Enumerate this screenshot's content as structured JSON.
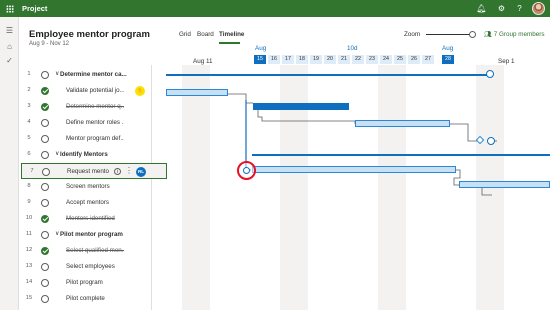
{
  "topbar": {
    "app_name": "Project",
    "icons": [
      "waffle-icon",
      "bell-icon",
      "gear-icon",
      "help-icon"
    ]
  },
  "leftnav": {
    "icons": [
      "hamburger-icon",
      "home-icon",
      "checkmark-icon"
    ]
  },
  "header": {
    "title": "Employee mentor program",
    "dates": "Aug 9 - Nov 12",
    "views": [
      "Grid",
      "Board",
      "Timeline"
    ],
    "active_view": "Timeline",
    "zoom_label": "Zoom",
    "members": "7 Group members"
  },
  "timeline_header": {
    "month": "Aug",
    "week_labels": [
      "Aug 11",
      "Sep 1"
    ],
    "range_label": "10d",
    "range_right_label": "Aug",
    "days": [
      "15",
      "16",
      "17",
      "18",
      "19",
      "20",
      "21",
      "22",
      "23",
      "24",
      "25",
      "26",
      "27",
      "28"
    ]
  },
  "tasks": [
    {
      "num": "1",
      "name": "Determine mentor ca...",
      "summary": true,
      "done": false
    },
    {
      "num": "2",
      "name": "Validate potential jo...",
      "done": true,
      "struck": false,
      "assignee": "hand"
    },
    {
      "num": "3",
      "name": "Determine mentor q...",
      "done": true,
      "struck": true
    },
    {
      "num": "4",
      "name": "Define mentor roles ...",
      "done": false
    },
    {
      "num": "5",
      "name": "Mentor program def...",
      "done": false
    },
    {
      "num": "6",
      "name": "Identify Mentors",
      "summary": true,
      "done": false
    },
    {
      "num": "7",
      "name": "Request mento",
      "done": false,
      "selected": true,
      "assignee": "RL"
    },
    {
      "num": "8",
      "name": "Screen mentors",
      "done": false
    },
    {
      "num": "9",
      "name": "Accept mentors",
      "done": false
    },
    {
      "num": "10",
      "name": "Mentors identified",
      "done": true,
      "struck": true
    },
    {
      "num": "11",
      "name": "Pilot mentor program",
      "summary": true,
      "done": false
    },
    {
      "num": "12",
      "name": "Select qualified men...",
      "done": true,
      "struck": true
    },
    {
      "num": "13",
      "name": "Select employees",
      "done": false
    },
    {
      "num": "14",
      "name": "Pilot program",
      "done": false
    },
    {
      "num": "15",
      "name": "Pilot complete",
      "done": false
    }
  ],
  "colors": {
    "brand": "#31752f",
    "bar": "#c7e0f4",
    "bar_border": "#2b88d8",
    "accent": "#106ebe",
    "marker": "#e81123"
  }
}
